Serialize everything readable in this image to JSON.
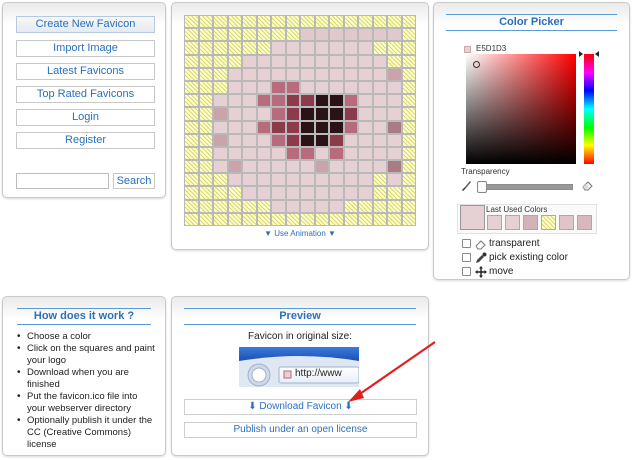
{
  "nav": {
    "items": [
      "Create New Favicon",
      "Import Image",
      "Latest Favicons",
      "Top Rated Favicons",
      "Login",
      "Register"
    ],
    "search_placeholder": "",
    "search_button": "Search"
  },
  "editor": {
    "anim_link": "▼ Use Animation ▼",
    "grid_size": 16,
    "pixels": [
      "TTTTTTTTTTTTTTTT",
      "TTTTTTTTAAAAAAAT",
      "TTTTTTBBBBBBBTTT",
      "TTTTBBBBBBBBBBTT",
      "TTTBBBBBBBBBBBCT",
      "TTTBBBDDBBBBBBBT",
      "TTBBBDDEEFFDBBBT",
      "TTCBBBDEFFFEBBBT",
      "TTBBBDEEFFFDBBGT",
      "TTCBBBDEFFEBBBBT",
      "TTBBBBBDDBDBBBBT",
      "TTBCBBBBBCBBBBGT",
      "TTTBBBBBBBBBBTBT",
      "TTTTBBBBBBBBBTTT",
      "TTTTTTBBBBBTTTTT",
      "TTTTTTTTTTTTTTTT"
    ],
    "palette": {
      "T": "transparent",
      "A": "#e0c8cc",
      "B": "#e5d1d3",
      "C": "#c9a4ab",
      "D": "#b76b7c",
      "E": "#8d3b4b",
      "F": "#2a1216",
      "G": "#a77c86"
    }
  },
  "picker": {
    "title": "Color Picker",
    "current_hex": "E5D1D3",
    "current_color": "#e5d1d3",
    "transparency_label": "Transparency",
    "last_used_label": "Last Used Colors",
    "recent_colors": [
      "#e5d1d3",
      "#e5d1d3",
      "#d3b2b9",
      "transparent",
      "#e0c4ca",
      "#d8b7bd"
    ],
    "options": [
      {
        "icon": "eraser-icon",
        "label": "transparent"
      },
      {
        "icon": "eyedropper-icon",
        "label": "pick existing color"
      },
      {
        "icon": "move-icon",
        "label": "move"
      }
    ]
  },
  "how": {
    "title": "How does it work ?",
    "steps": [
      "Choose a color",
      "Click on the squares and paint your logo",
      "Download when you are finished",
      "Put the favicon.ico file into your webserver directory",
      "Optionally publish it under the CC (Creative Commons) license"
    ]
  },
  "preview": {
    "title": "Preview",
    "original_size_label": "Favicon in original size:",
    "address_text": "http://www",
    "download_label": "⬇ Download Favicon ⬇",
    "publish_label": "Publish under an open license"
  },
  "colors": {
    "accent": "#2a6fbd",
    "arrow": "#e02020"
  }
}
